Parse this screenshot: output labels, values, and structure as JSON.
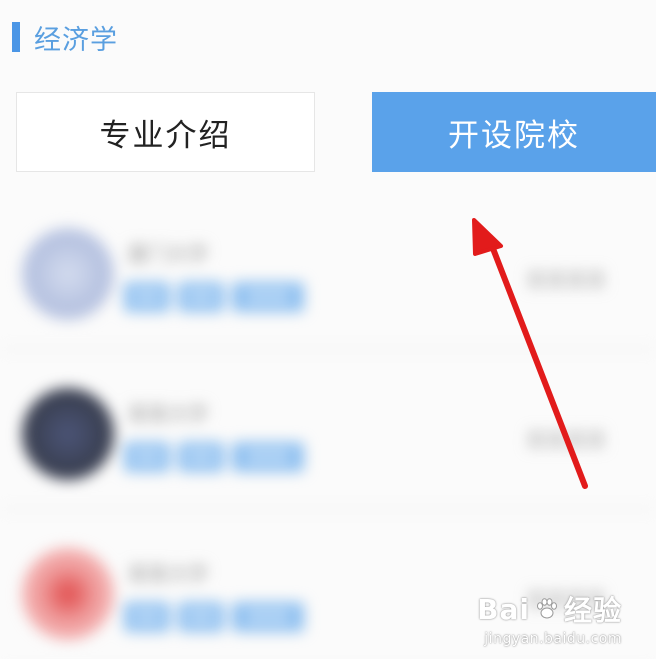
{
  "section": {
    "title": "经济学"
  },
  "tabs": [
    {
      "label": "专业介绍",
      "active": false
    },
    {
      "label": "开设院校",
      "active": true
    }
  ],
  "schools": [
    {
      "name": "厦门大学",
      "logo_color": "#b6c2e0",
      "meta": "某某某某",
      "tags": [
        "某某",
        "某某",
        "某某某"
      ]
    },
    {
      "name": "某某大学",
      "logo_color": "#3b4154",
      "meta": "某某某某",
      "tags": [
        "某某",
        "某某",
        "某某某"
      ]
    },
    {
      "name": "某某大学",
      "logo_color": "#f0a0a0",
      "meta": "某某某某",
      "tags": [
        "某某",
        "某某",
        "某某某"
      ]
    }
  ],
  "colors": {
    "accent": "#5aa2ea",
    "arrow": "#e21b1b"
  },
  "watermark": {
    "brand_left": "Bai",
    "brand_right": "经验",
    "url": "jingyan.baidu.com",
    "icon": "paw-icon"
  }
}
